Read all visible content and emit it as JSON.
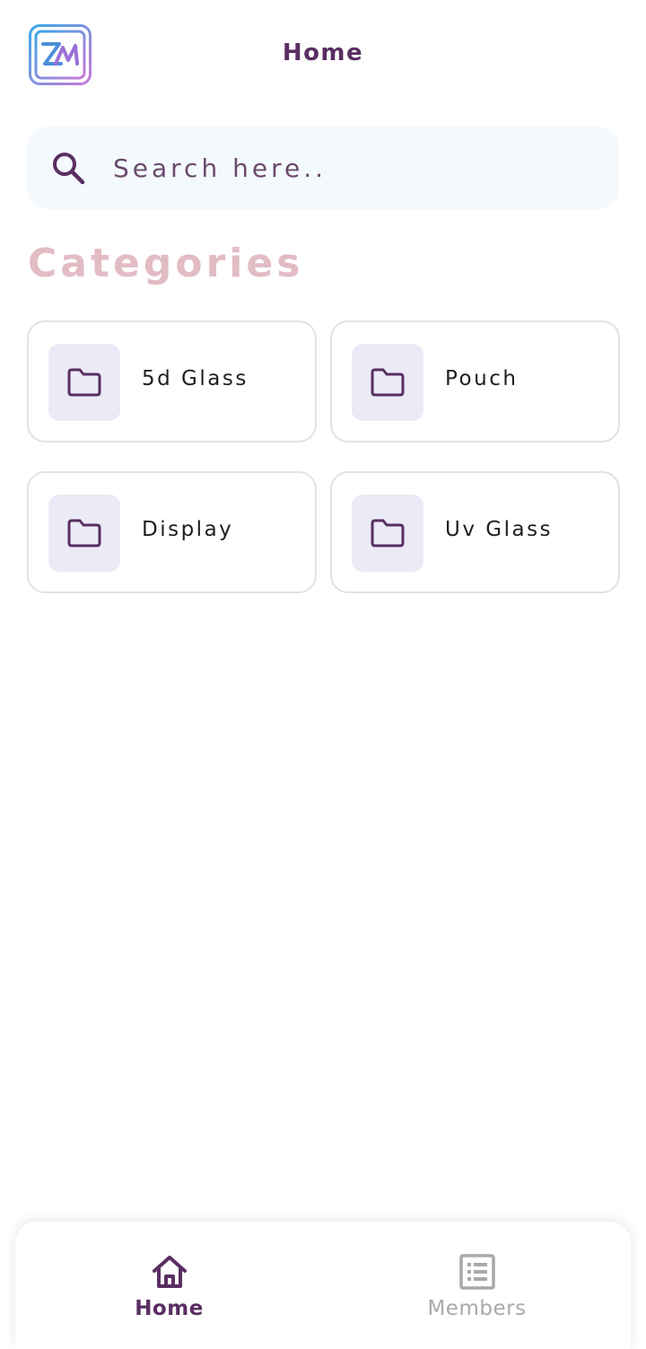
{
  "header": {
    "title": "Home",
    "logo_icon": "zm-logo-icon"
  },
  "search": {
    "placeholder": "Search here..",
    "value": "",
    "icon": "search-icon"
  },
  "categories": {
    "title": "Categories",
    "items": [
      {
        "label": "5d Glass",
        "icon": "folder-icon"
      },
      {
        "label": "Pouch",
        "icon": "folder-icon"
      },
      {
        "label": "Display",
        "icon": "folder-icon"
      },
      {
        "label": "Uv Glass",
        "icon": "folder-icon"
      }
    ]
  },
  "bottom_nav": {
    "items": [
      {
        "label": "Home",
        "icon": "home-icon",
        "active": true
      },
      {
        "label": "Members",
        "icon": "list-icon",
        "active": false
      }
    ]
  },
  "colors": {
    "primary": "#5a2e62",
    "categories_title": "#e2bcc4",
    "search_bg": "#f4f9fe",
    "icon_box_bg": "#ebebf7",
    "inactive": "#a9a9a9"
  }
}
